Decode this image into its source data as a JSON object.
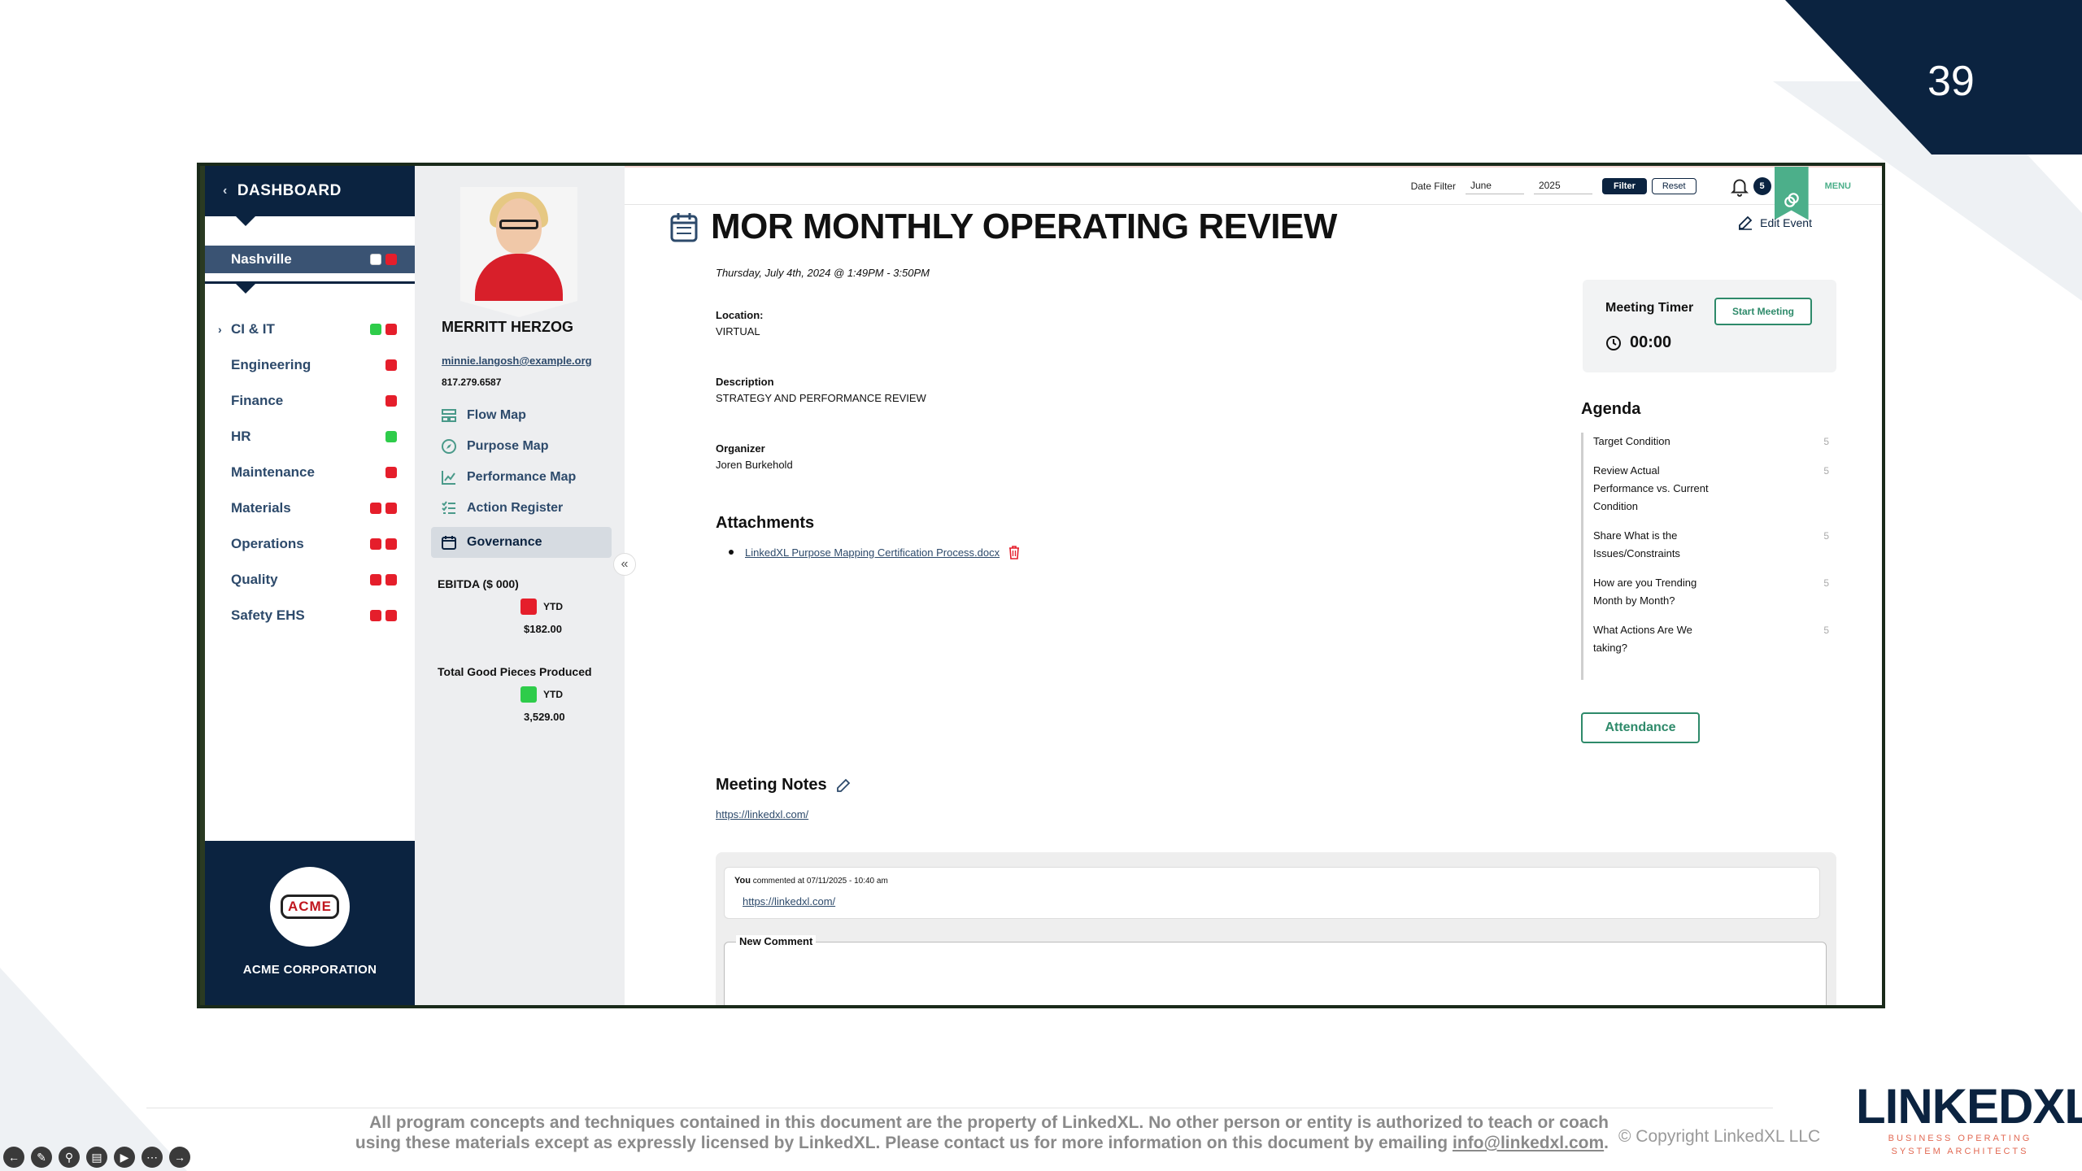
{
  "slide": {
    "page_number": "39",
    "footer_text_1": "All program concepts and techniques contained in this document are the property of LinkedXL.  No other person or entity is authorized to teach or coach",
    "footer_text_2a": "using these materials except as  expressly licensed by LinkedXL.  Please contact us for more information on this document by emailing ",
    "footer_email": "info@linkedxl.com",
    "footer_period": ".",
    "copyright": "© Copyright LinkedXL LLC",
    "brand_name": "LINKEDXL",
    "brand_tagline_1": "BUSINESS OPERATING",
    "brand_tagline_2": "SYSTEM ARCHITECTS"
  },
  "nav": {
    "header": "DASHBOARD",
    "site": "Nashville",
    "items": [
      {
        "label": "CI & IT",
        "status": [
          "green",
          "red"
        ]
      },
      {
        "label": "Engineering",
        "status": [
          "red"
        ]
      },
      {
        "label": "Finance",
        "status": [
          "red"
        ]
      },
      {
        "label": "HR",
        "status": [
          "green"
        ]
      },
      {
        "label": "Maintenance",
        "status": [
          "red"
        ]
      },
      {
        "label": "Materials",
        "status": [
          "red",
          "red"
        ]
      },
      {
        "label": "Operations",
        "status": [
          "red",
          "red"
        ]
      },
      {
        "label": "Quality",
        "status": [
          "red",
          "red"
        ]
      },
      {
        "label": "Safety EHS",
        "status": [
          "red",
          "red"
        ]
      }
    ],
    "logo_text": "ACME",
    "company": "ACME CORPORATION"
  },
  "profile": {
    "name": "MERRITT HERZOG",
    "email": "minnie.langosh@example.org",
    "phone": "817.279.6587",
    "menu": [
      "Flow Map",
      "Purpose Map",
      "Performance Map",
      "Action Register",
      "Governance"
    ],
    "kpis": [
      {
        "title": "EBITDA ($ 000)",
        "status": "red",
        "period": "YTD",
        "value": "$182.00"
      },
      {
        "title": "Total Good Pieces Produced",
        "status": "green",
        "period": "YTD",
        "value": "3,529.00"
      }
    ]
  },
  "topbar": {
    "date_filter_label": "Date Filter",
    "month": "June",
    "year": "2025",
    "filter_btn": "Filter",
    "reset_btn": "Reset",
    "notifications": "5",
    "menu_label": "MENU"
  },
  "event": {
    "title": "MOR MONTHLY OPERATING REVIEW",
    "edit_label": "Edit Event",
    "datetime": "Thursday, July 4th, 2024 @ 1:49PM - 3:50PM",
    "location_label": "Location:",
    "location": "VIRTUAL",
    "description_label": "Description",
    "description": "STRATEGY AND PERFORMANCE REVIEW",
    "organizer_label": "Organizer",
    "organizer": "Joren Burkehold",
    "attachments_title": "Attachments",
    "attachment": "LinkedXL Purpose Mapping Certification Process.docx",
    "notes_title": "Meeting Notes",
    "notes_link": "https://linkedxl.com/",
    "comment_author": "You",
    "comment_meta": " commented at 07/11/2025 - 10:40 am",
    "comment_link": "https://linkedxl.com/",
    "new_comment_label": "New Comment"
  },
  "timer": {
    "label": "Meeting Timer",
    "start_btn": "Start Meeting",
    "value": "00:00"
  },
  "agenda": {
    "title": "Agenda",
    "items": [
      {
        "label": "Target Condition",
        "minutes": "5"
      },
      {
        "label": "Review Actual Performance vs. Current Condition",
        "minutes": "5"
      },
      {
        "label": "Share What is the Issues/Constraints",
        "minutes": "5"
      },
      {
        "label": "How are you Trending Month by Month?",
        "minutes": "5"
      },
      {
        "label": "What Actions Are We taking?",
        "minutes": "5"
      }
    ],
    "attendance_btn": "Attendance"
  },
  "colors": {
    "navy": "#0b2340",
    "accent_green": "#2e8a6a",
    "status_red": "#e51e2b",
    "status_green": "#2ecc4a"
  }
}
